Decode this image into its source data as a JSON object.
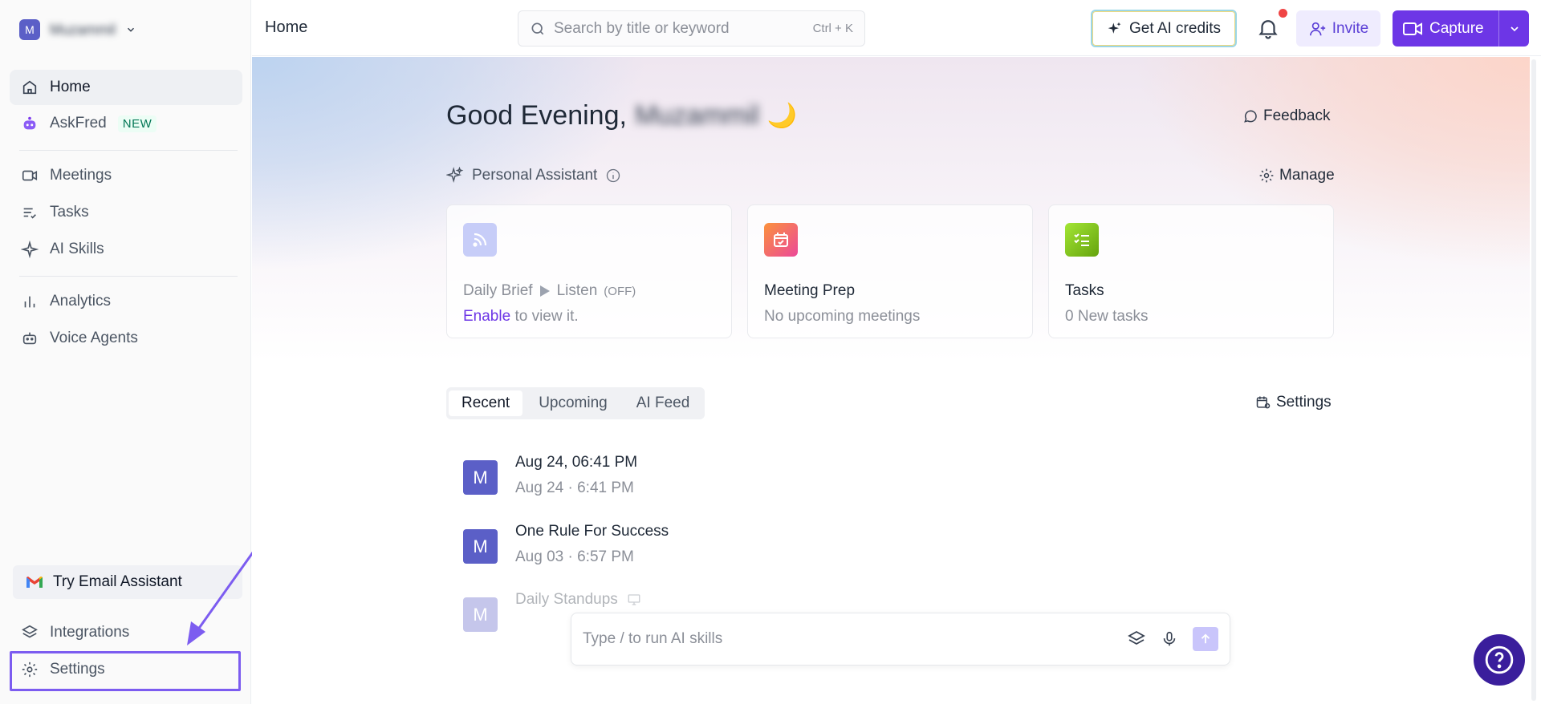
{
  "workspace": {
    "avatar_letter": "M",
    "name": "Muzammil"
  },
  "sidebar": {
    "items": [
      {
        "label": "Home"
      },
      {
        "label": "AskFred",
        "badge": "NEW"
      },
      {
        "label": "Meetings"
      },
      {
        "label": "Tasks"
      },
      {
        "label": "AI Skills"
      },
      {
        "label": "Analytics"
      },
      {
        "label": "Voice Agents"
      }
    ],
    "email_assistant": "Try Email Assistant",
    "integrations": "Integrations",
    "settings": "Settings"
  },
  "topbar": {
    "breadcrumb": "Home",
    "search_placeholder": "Search by title or keyword",
    "search_shortcut": "Ctrl + K",
    "ai_credits": "Get AI credits",
    "invite": "Invite",
    "capture": "Capture"
  },
  "greeting": {
    "text": "Good Evening,",
    "name": "Muzammil",
    "emoji": "🌙"
  },
  "feedback": "Feedback",
  "assistant": {
    "title": "Personal Assistant",
    "manage": "Manage",
    "cards": [
      {
        "title": "Daily Brief",
        "listen": "Listen",
        "listen_state": "(OFF)",
        "link": "Enable",
        "subtitle": "to view it."
      },
      {
        "title": "Meeting Prep",
        "subtitle": "No upcoming meetings"
      },
      {
        "title": "Tasks",
        "subtitle": "0 New tasks"
      }
    ]
  },
  "feed": {
    "tabs": [
      "Recent",
      "Upcoming",
      "AI Feed"
    ],
    "active_tab": "Recent",
    "settings": "Settings",
    "meetings": [
      {
        "avatar": "M",
        "title": "Aug 24, 06:41 PM",
        "date": "Aug 24 · 6:41 PM"
      },
      {
        "avatar": "M",
        "title": "One Rule For Success",
        "date": "Aug 03 · 6:57 PM"
      },
      {
        "avatar": "M",
        "title": "Daily Standups",
        "date": ""
      }
    ]
  },
  "composer": {
    "placeholder": "Type / to run AI skills"
  },
  "colors": {
    "accent": "#6d36e6",
    "avatar": "#5b5fc7",
    "highlight": "#7c5cf0",
    "help": "#3a1e9c"
  }
}
